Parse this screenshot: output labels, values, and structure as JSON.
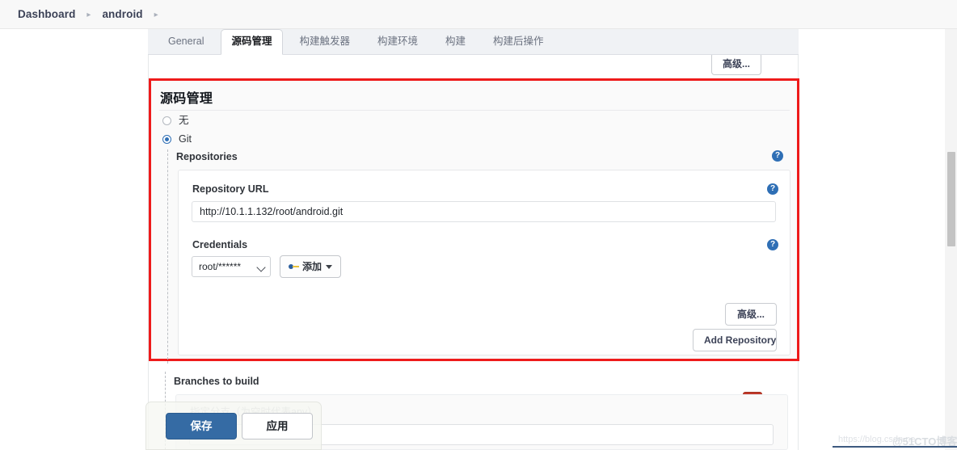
{
  "breadcrumb": {
    "items": [
      "Dashboard",
      "android"
    ],
    "separator": "▸"
  },
  "tabs": [
    {
      "label": "General",
      "active": false
    },
    {
      "label": "源码管理",
      "active": true
    },
    {
      "label": "构建触发器",
      "active": false
    },
    {
      "label": "构建环境",
      "active": false
    },
    {
      "label": "构建",
      "active": false
    },
    {
      "label": "构建后操作",
      "active": false
    }
  ],
  "top_advanced_button": "高级...",
  "scm_section": {
    "title": "源码管理",
    "radios": [
      {
        "label": "无",
        "checked": false
      },
      {
        "label": "Git",
        "checked": true
      }
    ],
    "repositories_label": "Repositories",
    "repository": {
      "url_label": "Repository URL",
      "url_value": "http://10.1.1.132/root/android.git",
      "credentials_label": "Credentials",
      "credentials_value": "root/******",
      "add_credentials_button": "添加",
      "advanced_button": "高级...",
      "add_repository_button": "Add Repository"
    }
  },
  "branches": {
    "label": "Branches to build",
    "hint": "指定分支（为空时代表any）",
    "value": "",
    "delete_button": "X"
  },
  "help_icon_glyph": "?",
  "save_bar": {
    "save_label": "保存",
    "apply_label": "应用"
  },
  "watermarks": {
    "csdn": "https://blog.csdn.ne",
    "cto": "@51CTO博客"
  },
  "colors": {
    "highlight_red": "#ee1b1b",
    "accent_blue": "#2f6fb5",
    "save_blue": "#356ba4",
    "delete_red": "#c0392b"
  }
}
